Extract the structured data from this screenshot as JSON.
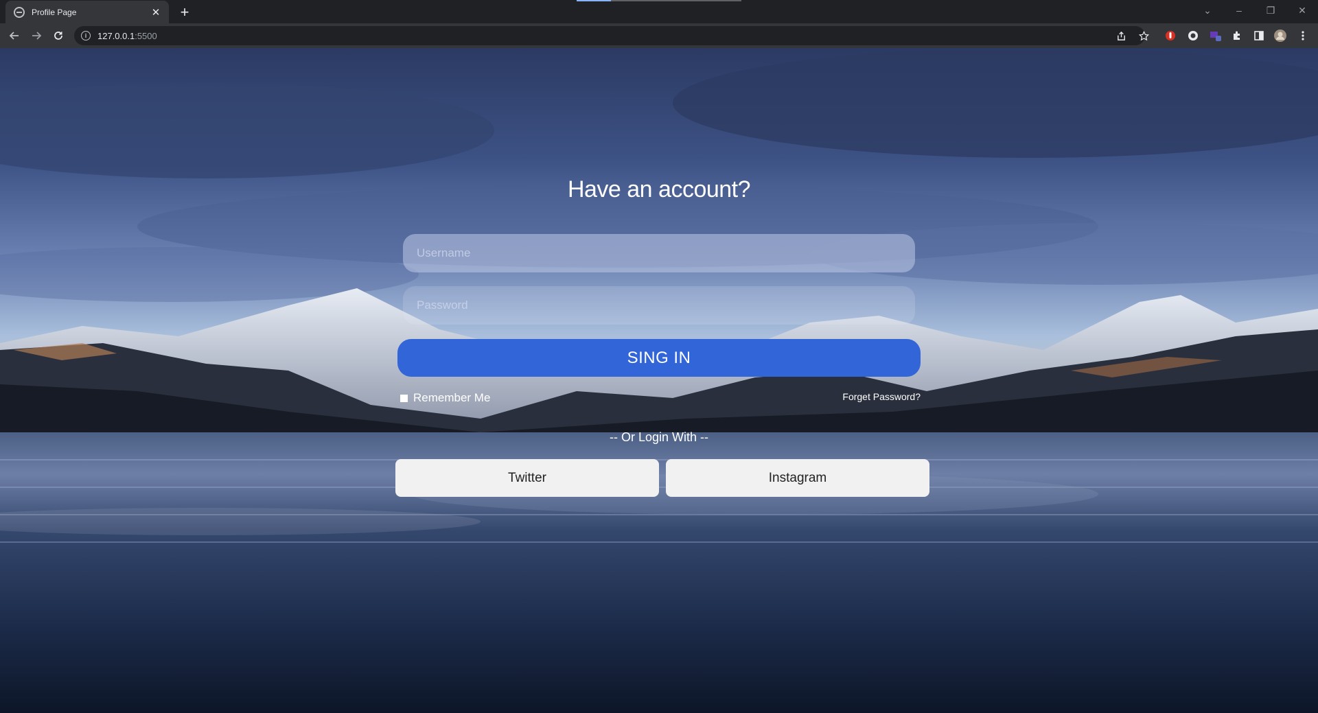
{
  "browser": {
    "tab": {
      "title": "Profile Page",
      "close": "✕"
    },
    "new_tab": "+",
    "address": {
      "host": "127.0.0.1",
      "port": ":5500"
    },
    "window_controls": [
      "⌄",
      "–",
      "❐",
      "✕"
    ]
  },
  "login": {
    "title": "Have an account?",
    "username_placeholder": "Username",
    "password_placeholder": "Password",
    "signin_label": "SING IN",
    "remember_label": "Remember Me",
    "forgot_label": "Forget Password?",
    "or_login_label": "-- Or Login With --",
    "twitter_label": "Twitter",
    "instagram_label": "Instagram"
  },
  "icons": {
    "back": "back-arrow-icon",
    "forward": "forward-arrow-icon",
    "reload": "reload-icon",
    "info": "info-icon",
    "share": "share-icon",
    "bookmark": "star-icon",
    "extensions": "puzzle-icon",
    "sidepanel": "side-panel-icon",
    "profile": "avatar",
    "menu": "kebab-menu-icon"
  },
  "colors": {
    "signin_button": "#3165d8",
    "social_button": "#f1f1f1"
  }
}
